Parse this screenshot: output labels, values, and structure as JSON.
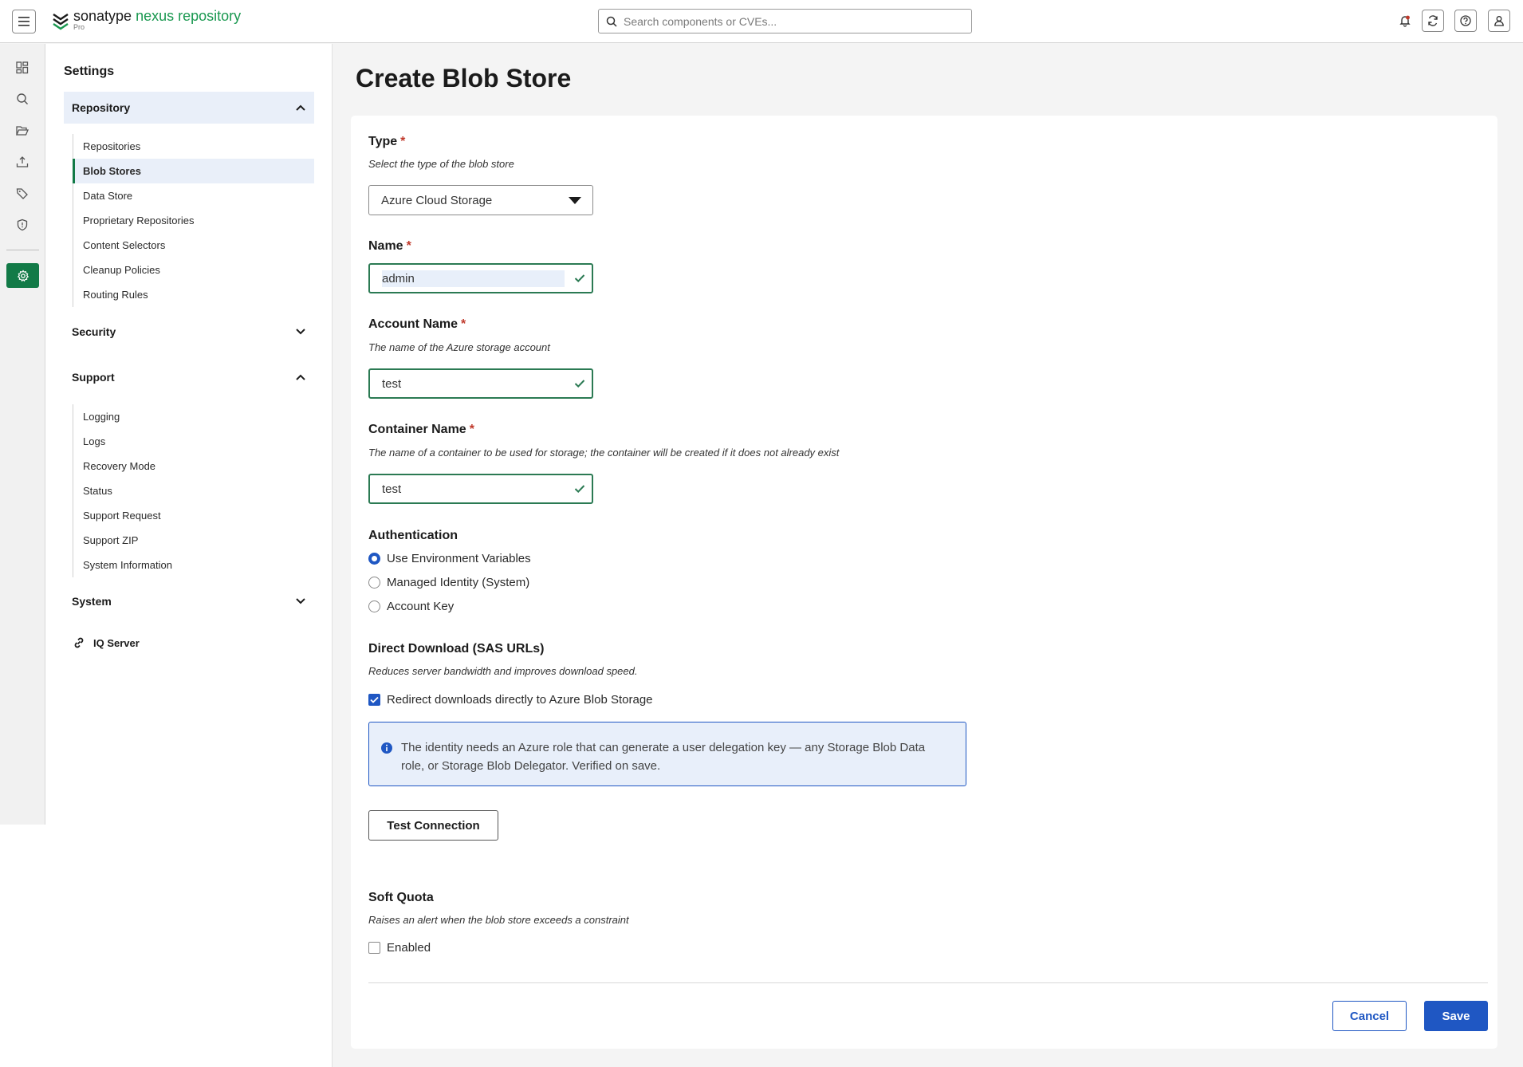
{
  "header": {
    "brand": "sonatype",
    "product": "nexus repository",
    "edition": "Pro",
    "search_placeholder": "Search components or CVEs..."
  },
  "nav": {
    "title": "Settings",
    "repository": {
      "label": "Repository",
      "items": [
        "Repositories",
        "Blob Stores",
        "Data Store",
        "Proprietary Repositories",
        "Content Selectors",
        "Cleanup Policies",
        "Routing Rules"
      ]
    },
    "security": {
      "label": "Security"
    },
    "support": {
      "label": "Support",
      "items": [
        "Logging",
        "Logs",
        "Recovery Mode",
        "Status",
        "Support Request",
        "Support ZIP",
        "System Information"
      ]
    },
    "system": {
      "label": "System"
    },
    "iq_server": "IQ Server"
  },
  "page": {
    "title": "Create Blob Store"
  },
  "form": {
    "type": {
      "label": "Type",
      "required": "*",
      "hint": "Select the type of the blob store",
      "value": "Azure Cloud Storage"
    },
    "name": {
      "label": "Name",
      "required": "*",
      "value": "admin"
    },
    "account_name": {
      "label": "Account Name",
      "required": "*",
      "hint": "The name of the Azure storage account",
      "value": "test"
    },
    "container_name": {
      "label": "Container Name",
      "required": "*",
      "hint": "The name of a container to be used for storage; the container will be created if it does not already exist",
      "value": "test"
    },
    "authentication": {
      "label": "Authentication",
      "options": [
        "Use Environment Variables",
        "Managed Identity (System)",
        "Account Key"
      ],
      "selected": "Use Environment Variables"
    },
    "direct_download": {
      "label": "Direct Download (SAS URLs)",
      "hint": "Reduces server bandwidth and improves download speed.",
      "checkbox_label": "Redirect downloads directly to Azure Blob Storage",
      "checked": true,
      "info": "The identity needs an Azure role that can generate a user delegation key — any Storage Blob Data role, or Storage Blob Delegator. Verified on save."
    },
    "test_connection_label": "Test Connection",
    "soft_quota": {
      "label": "Soft Quota",
      "hint": "Raises an alert when the blob store exceeds a constraint",
      "checkbox_label": "Enabled",
      "checked": false
    },
    "cancel_label": "Cancel",
    "save_label": "Save"
  },
  "colors": {
    "brand_green": "#127a47",
    "accent_blue": "#1f57c3",
    "required_red": "#c0392b"
  }
}
